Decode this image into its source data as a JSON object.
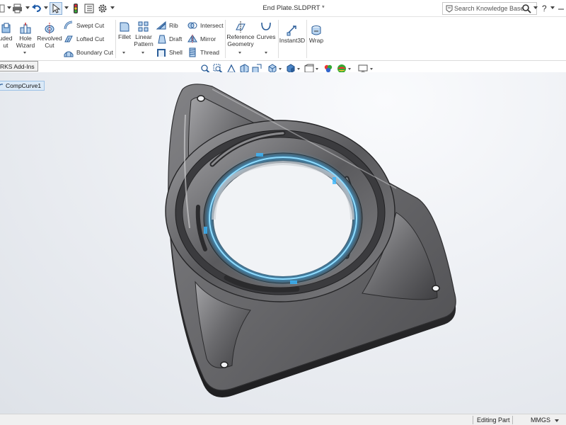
{
  "window": {
    "title": "End Plate.SLDPRT *"
  },
  "search": {
    "placeholder": "Search Knowledge Base"
  },
  "command_manager": {
    "extruded_cut": "uded\nut",
    "hole_wizard": "Hole\nWizard",
    "revolved_cut": "Revolved\nCut",
    "swept_cut": "Swept Cut",
    "lofted_cut": "Lofted Cut",
    "boundary_cut": "Boundary Cut",
    "fillet": "Fillet",
    "linear_pattern": "Linear\nPattern",
    "rib": "Rib",
    "draft": "Draft",
    "shell": "Shell",
    "intersect": "Intersect",
    "mirror": "Mirror",
    "thread": "Thread",
    "reference_geometry": "Reference\nGeometry",
    "curves": "Curves",
    "instant3d": "Instant3D",
    "wrap": "Wrap"
  },
  "tabs": {
    "addins": "RKS Add-Ins"
  },
  "feature_tree": {
    "selected_item": "CompCurve1"
  },
  "status_bar": {
    "mode": "Editing Part",
    "units": "MMGS"
  },
  "colors": {
    "selection_highlight": "#3ab8ff",
    "part_metal": "#6e6e70",
    "tree_selection": "#dbe9f7"
  }
}
